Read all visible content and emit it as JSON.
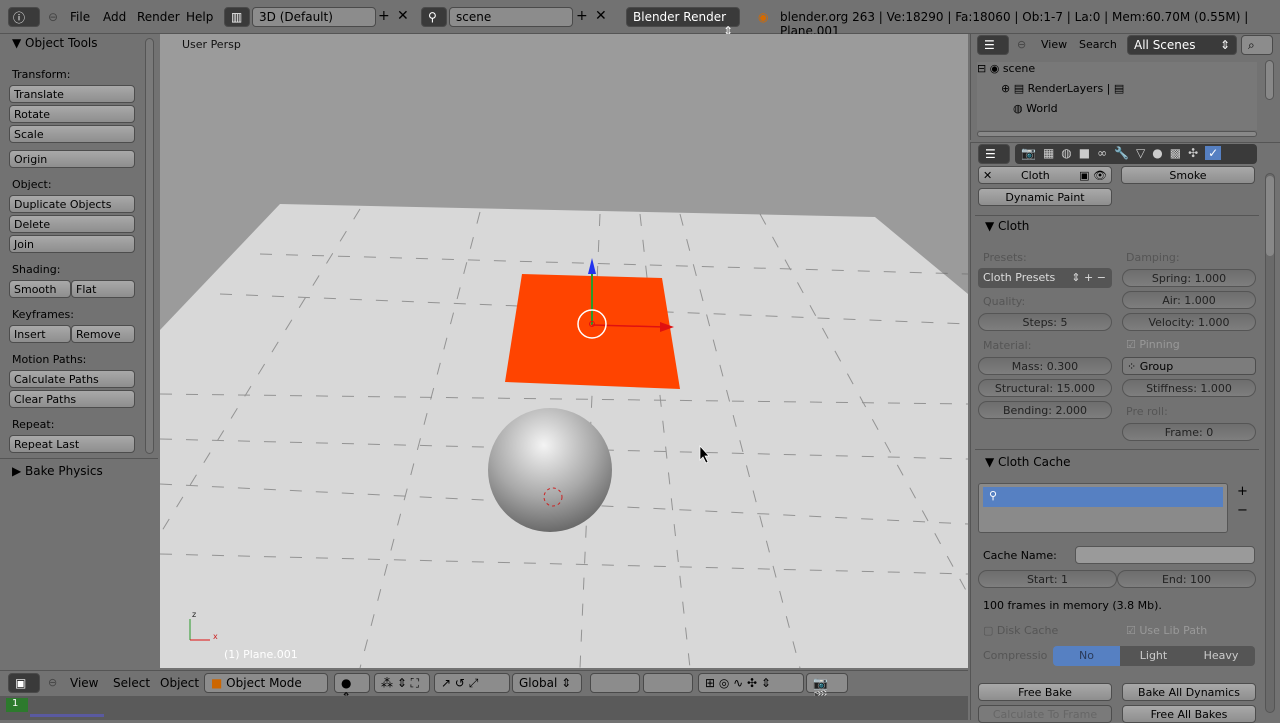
{
  "topbar": {
    "menus": [
      "File",
      "Add",
      "Render",
      "Help"
    ],
    "screen_layout": "3D (Default)",
    "scene": "scene",
    "render_engine": "Blender Render",
    "status": "blender.org 263 | Ve:18290 | Fa:18060 | Ob:1-7 | La:0 | Mem:60.70M (0.55M) | Plane.001"
  },
  "toolshelf": {
    "title": "Object Tools",
    "sections": [
      {
        "label": "Transform:",
        "buttons": [
          "Translate",
          "Rotate",
          "Scale"
        ]
      },
      {
        "label": "",
        "buttons": [
          "Origin"
        ]
      },
      {
        "label": "Object:",
        "buttons": [
          "Duplicate Objects",
          "Delete",
          "Join"
        ]
      },
      {
        "label": "Shading:",
        "pair": [
          "Smooth",
          "Flat"
        ]
      },
      {
        "label": "Keyframes:",
        "pair": [
          "Insert",
          "Remove"
        ]
      },
      {
        "label": "Motion Paths:",
        "buttons": [
          "Calculate Paths",
          "Clear Paths"
        ]
      },
      {
        "label": "Repeat:",
        "buttons": [
          "Repeat Last"
        ]
      }
    ],
    "bake_physics": "Bake Physics"
  },
  "viewport": {
    "view_name": "User Persp",
    "object_label": "(1) Plane.001",
    "axis_x": "x",
    "axis_z": "z",
    "colors": {
      "selected_plane": "#ff4400",
      "floor": "#d8d8d8"
    }
  },
  "viewport_header": {
    "menus": [
      "View",
      "Select",
      "Object"
    ],
    "mode": "Object Mode",
    "orientation": "Global"
  },
  "timeline": {
    "current_frame": "1"
  },
  "outliner": {
    "menus": [
      "View",
      "Search"
    ],
    "filter": "All Scenes",
    "tree": [
      "scene",
      "RenderLayers",
      "World"
    ]
  },
  "properties": {
    "modifiers": {
      "cloth": "Cloth",
      "smoke": "Smoke",
      "dynamic_paint": "Dynamic Paint"
    },
    "cloth": {
      "title": "Cloth",
      "presets_label": "Presets:",
      "presets_value": "Cloth Presets",
      "quality_label": "Quality:",
      "steps": "Steps: 5",
      "material_label": "Material:",
      "mass": "Mass: 0.300",
      "structural": "Structural: 15.000",
      "bending": "Bending: 2.000",
      "damping_label": "Damping:",
      "spring": "Spring: 1.000",
      "air": "Air: 1.000",
      "velocity": "Velocity: 1.000",
      "pinning": "Pinning",
      "pinning_checked": true,
      "group": "Group",
      "stiffness": "Stiffness: 1.000",
      "preroll_label": "Pre roll:",
      "frame": "Frame: 0"
    },
    "cache": {
      "title": "Cloth Cache",
      "cache_name_label": "Cache Name:",
      "cache_name": "",
      "start": "Start: 1",
      "end": "End: 100",
      "info": "100 frames in memory (3.8 Mb).",
      "disk_cache": "Disk Cache",
      "disk_cache_checked": false,
      "use_lib_path": "Use Lib Path",
      "use_lib_path_checked": true,
      "compression_label": "Compressio",
      "compression_options": [
        "No",
        "Light",
        "Heavy"
      ],
      "compression_selected": "No",
      "free_bake": "Free Bake",
      "bake_all": "Bake All Dynamics",
      "calc_to_frame": "Calculate To Frame",
      "free_all": "Free All Bakes"
    }
  }
}
